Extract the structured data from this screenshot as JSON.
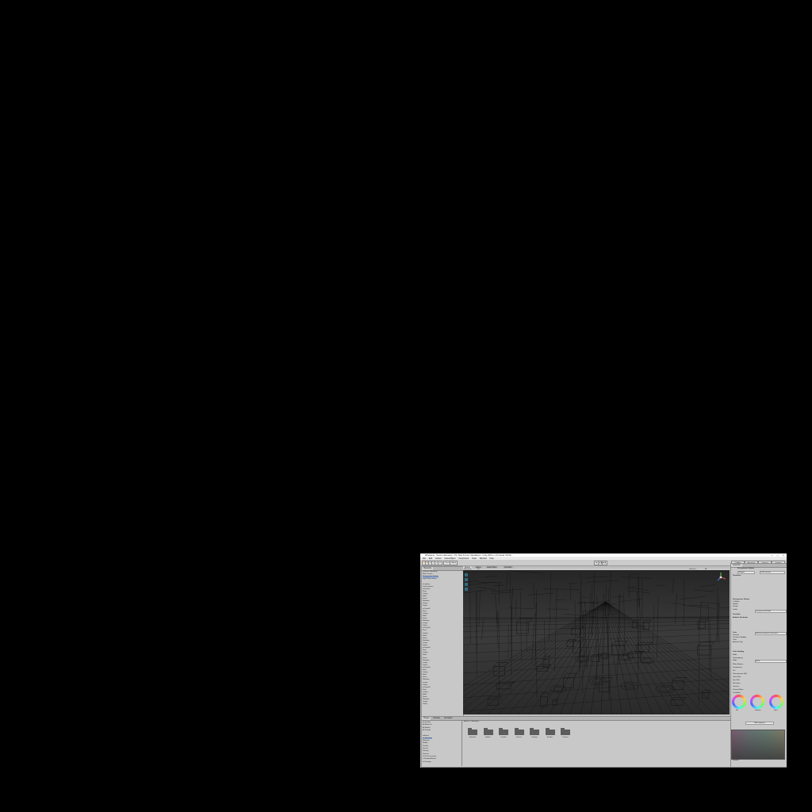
{
  "window": {
    "title": "Wireframe - Scene Laboratory - PC, Mac & Linux Standalone - Unity 2019.x.x Personal <DX11>",
    "controls": "— ▢ ✕"
  },
  "menu": [
    "File",
    "Edit",
    "Assets",
    "GameObject",
    "Component",
    "Tools",
    "Window",
    "Help"
  ],
  "toolbar": {
    "play": "▶",
    "pause": "❚❚",
    "step": "▶❚",
    "tools": [
      "✋",
      "✥",
      "⟳",
      "⤢",
      "▭",
      "⊕"
    ],
    "pivot": "Pivot",
    "global": "Global",
    "collab": "Collab ▾",
    "account": "Account ▾",
    "layers": "Layers ▾",
    "layout": "Layout ▾"
  },
  "hierarchy": {
    "tab": "Hierarchy",
    "items": [
      "▾ Scene Laboratory*",
      "  Main Camera",
      "  Post-process Volume",
      "  Light Probe Group",
      "  ",
      "  ▸ Lighting",
      "  ▸ Environment",
      "  ▾ Room01",
      "    Floor",
      "    Ceiling",
      "    Walls",
      "    Doors",
      "    Windows",
      "    Lamps",
      "    Tables",
      "  ▾ Room02",
      "    Floor",
      "    Ceiling",
      "    Walls",
      "    Doors",
      "    Windows",
      "    Lamps",
      "    Tables",
      "  ▾ Room03",
      "    Floor",
      "    Ceiling",
      "    Walls",
      "    Doors",
      "    Windows",
      "    Lamps",
      "    Tables",
      "  ▾ Room04",
      "    Floor",
      "    Ceiling",
      "    Walls",
      "    Doors",
      "    Windows",
      "    Lamps",
      "    Tables",
      "  ▾ Room05",
      "    Floor",
      "    Ceiling",
      "    Walls",
      "    Doors",
      "    Windows",
      "    Lamps",
      "    Tables",
      "  ▾ Room06",
      "    Floor",
      "    Ceiling",
      "    Walls",
      "    Doors",
      "    Windows",
      "    Lamps",
      "    Tables"
    ]
  },
  "scene": {
    "tabs": [
      "Scene",
      "Game",
      "Asset Store",
      "Animator"
    ],
    "shading": "Wireframe",
    "mode": "2D",
    "gizmos": "Gizmos ▾",
    "search": "All"
  },
  "inspector": {
    "tab": "Inspector",
    "object_name": "Post-process Volume",
    "tag": "Untagged",
    "layer": "PostProcessing",
    "components": [
      "Transform",
      "Post-process Volume",
      "Is Global",
      "Weight",
      "Priority",
      "Profile",
      "Overrides",
      "Ambient Occlusion",
      "Mode",
      "Intensity",
      "Thickness Modifier",
      "Color",
      "Ambient Only",
      "Color Grading",
      "Mode",
      "Tonemapping",
      "Mode",
      "White Balance",
      "Temperature",
      "Tint",
      "Post-exposure (EV)",
      "Color Filter",
      "Hue Shift",
      "Saturation",
      "Contrast",
      "Channel Mixer",
      "Trackballs"
    ],
    "profile_value": "Post-process Vol Profile",
    "mode_value": "Multi Scale Volumetric Obscurance",
    "tonemap_value": "ACES",
    "wheels": [
      "Lift",
      "Gamma",
      "Gain"
    ],
    "add_component": "Add Component",
    "preview_label": "Preview"
  },
  "project": {
    "tabs": [
      "Project",
      "Console",
      "Animation"
    ],
    "breadcrumb": "Assets > Laboratory",
    "tree": [
      "▾ Favorites",
      "  All Materials",
      "  All Models",
      "  All Prefabs",
      "",
      "▾ Assets",
      "  ▸ Laboratory",
      "    Materials",
      "    Models",
      "    Prefabs",
      "    Scenes",
      "    Settings",
      "    Textures",
      "  ▸ Post Processing",
      "  ▸ Standard Assets",
      "▸ Packages"
    ],
    "folders": [
      "Materials",
      "Models",
      "Prefabs",
      "Scenes",
      "Settings",
      "Shaders",
      "Textures"
    ]
  },
  "colors": {
    "window_bg": "#c2c2c2",
    "scene_bg": "#3a3a3a",
    "wire": "#0c0c0c",
    "selection": "#8fa9d2"
  }
}
